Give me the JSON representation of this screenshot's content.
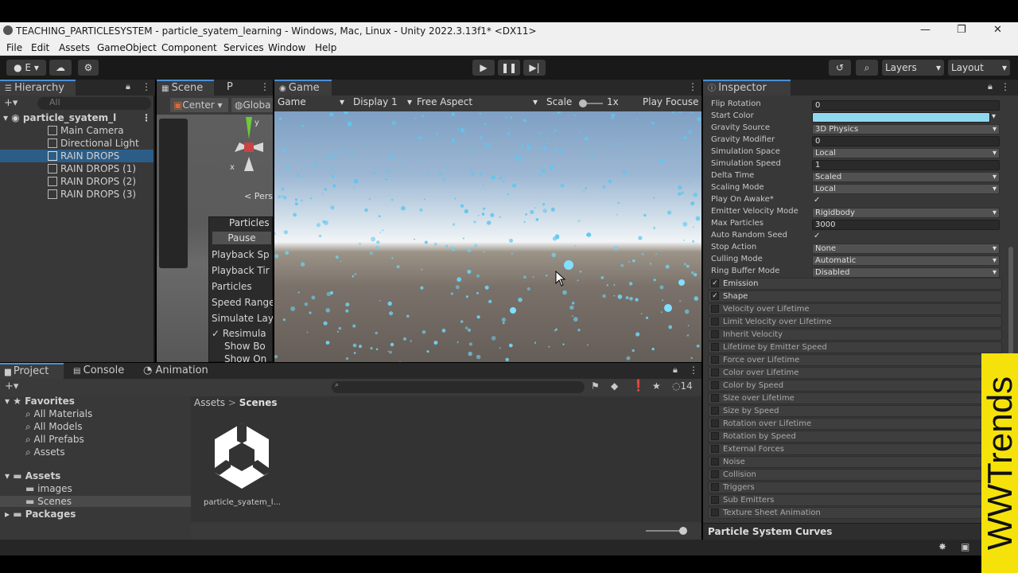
{
  "window": {
    "title": "TEACHING_PARTICLESYSTEM - particle_syatem_learning - Windows, Mac, Linux - Unity 2022.3.13f1* <DX11>"
  },
  "menu": [
    "File",
    "Edit",
    "Assets",
    "GameObject",
    "Component",
    "Services",
    "Window",
    "Help"
  ],
  "toolbar": {
    "account_label": "E",
    "layers": "Layers",
    "layout": "Layout"
  },
  "hierarchy": {
    "tab": "Hierarchy",
    "search_placeholder": "All",
    "scene": "particle_syatem_l",
    "items": [
      "Main Camera",
      "Directional Light",
      "RAIN DROPS",
      "RAIN DROPS (1)",
      "RAIN DROPS (2)",
      "RAIN DROPS (3)"
    ]
  },
  "scene": {
    "tab": "Scene",
    "tab2": "P",
    "pivot": "Center",
    "global": "Globa",
    "persp": "< Pers",
    "y_axis": "y",
    "x_axis": "x"
  },
  "particles_overlay": {
    "title": "Particles",
    "pause": "Pause",
    "rows": [
      "Playback Sp",
      "Playback Tir",
      "Particles",
      "Speed Range",
      "Simulate Lay"
    ],
    "resimulate": "Resimula",
    "show_bounds": "Show Bo",
    "show_only": "Show On"
  },
  "game": {
    "tab": "Game",
    "mode": "Game",
    "display": "Display 1",
    "aspect": "Free Aspect",
    "scale_label": "Scale",
    "scale_value": "1x",
    "play_focused": "Play Focuse"
  },
  "inspector": {
    "tab": "Inspector",
    "fields": [
      {
        "label": "Flip Rotation",
        "value": "0",
        "kind": "text"
      },
      {
        "label": "Start Color",
        "value": "",
        "kind": "color"
      },
      {
        "label": "Gravity Source",
        "value": "3D Physics",
        "kind": "dd"
      },
      {
        "label": "Gravity Modifier",
        "value": "0",
        "kind": "text"
      },
      {
        "label": "Simulation Space",
        "value": "Local",
        "kind": "dd"
      },
      {
        "label": "Simulation Speed",
        "value": "1",
        "kind": "text"
      },
      {
        "label": "Delta Time",
        "value": "Scaled",
        "kind": "dd"
      },
      {
        "label": "Scaling Mode",
        "value": "Local",
        "kind": "dd"
      },
      {
        "label": "Play On Awake*",
        "value": "✓",
        "kind": "check"
      },
      {
        "label": "Emitter Velocity Mode",
        "value": "Rigidbody",
        "kind": "dd"
      },
      {
        "label": "Max Particles",
        "value": "3000",
        "kind": "text"
      },
      {
        "label": "Auto Random Seed",
        "value": "✓",
        "kind": "check"
      },
      {
        "label": "Stop Action",
        "value": "None",
        "kind": "dd"
      },
      {
        "label": "Culling Mode",
        "value": "Automatic",
        "kind": "dd"
      },
      {
        "label": "Ring Buffer Mode",
        "value": "Disabled",
        "kind": "dd"
      }
    ],
    "modules": [
      {
        "label": "Emission",
        "on": true
      },
      {
        "label": "Shape",
        "on": true
      },
      {
        "label": "Velocity over Lifetime",
        "on": false
      },
      {
        "label": "Limit Velocity over Lifetime",
        "on": false
      },
      {
        "label": "Inherit Velocity",
        "on": false
      },
      {
        "label": "Lifetime by Emitter Speed",
        "on": false
      },
      {
        "label": "Force over Lifetime",
        "on": false
      },
      {
        "label": "Color over Lifetime",
        "on": false
      },
      {
        "label": "Color by Speed",
        "on": false
      },
      {
        "label": "Size over Lifetime",
        "on": false
      },
      {
        "label": "Size by Speed",
        "on": false
      },
      {
        "label": "Rotation over Lifetime",
        "on": false
      },
      {
        "label": "Rotation by Speed",
        "on": false
      },
      {
        "label": "External Forces",
        "on": false
      },
      {
        "label": "Noise",
        "on": false
      },
      {
        "label": "Collision",
        "on": false
      },
      {
        "label": "Triggers",
        "on": false
      },
      {
        "label": "Sub Emitters",
        "on": false
      },
      {
        "label": "Texture Sheet Animation",
        "on": false
      }
    ],
    "curves": "Particle System Curves"
  },
  "project": {
    "tabs": [
      "Project",
      "Console",
      "Animation"
    ],
    "hidden_count": "14",
    "favorites": "Favorites",
    "fav_items": [
      "All Materials",
      "All Models",
      "All Prefabs",
      "Assets"
    ],
    "assets": "Assets",
    "asset_folders": [
      "images",
      "Scenes"
    ],
    "packages": "Packages",
    "breadcrumb_root": "Assets",
    "breadcrumb_leaf": "Scenes",
    "asset_name": "particle_syatem_l..."
  },
  "watermark": "WWTrends",
  "colors": {
    "start_color": "#8fd8ef",
    "accent": "#4a8fd6",
    "selection": "#2c5d87",
    "watermark_bg": "#f5e20a"
  }
}
